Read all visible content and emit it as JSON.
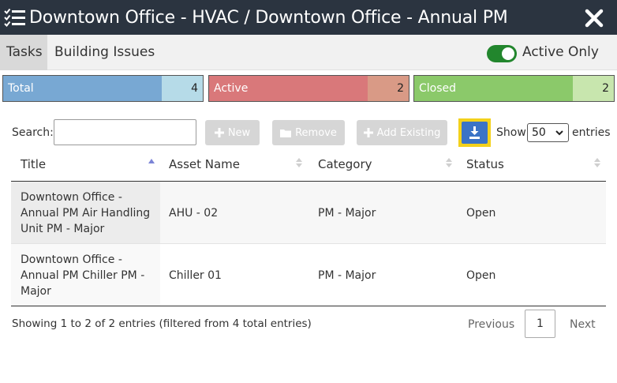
{
  "header": {
    "title": "Downtown Office - HVAC / Downtown Office - Annual PM"
  },
  "tabs": [
    {
      "label": "Tasks",
      "active": true
    },
    {
      "label": "Building Issues",
      "active": false
    }
  ],
  "filter": {
    "active_only_label": "Active Only",
    "active_only_on": true
  },
  "summary": {
    "total": {
      "label": "Total",
      "value": "4"
    },
    "active": {
      "label": "Active",
      "value": "2"
    },
    "closed": {
      "label": "Closed",
      "value": "2"
    }
  },
  "toolbar": {
    "search_label": "Search:",
    "search_value": "",
    "new_label": "New",
    "remove_label": "Remove",
    "add_existing_label": "Add Existing",
    "show_label": "Show",
    "entries_value": "50",
    "entries_label": "entries"
  },
  "table": {
    "columns": [
      "Title",
      "Asset Name",
      "Category",
      "Status"
    ],
    "rows": [
      {
        "title": "Downtown Office - Annual PM Air Handling Unit PM - Major",
        "asset": "AHU - 02",
        "category": "PM - Major",
        "status": "Open"
      },
      {
        "title": "Downtown Office - Annual PM Chiller PM - Major",
        "asset": "Chiller 01",
        "category": "PM - Major",
        "status": "Open"
      }
    ]
  },
  "footer": {
    "info": "Showing 1 to 2 of 2 entries (filtered from 4 total entries)",
    "previous_label": "Previous",
    "current_page": "1",
    "next_label": "Next"
  },
  "colors": {
    "header_bg": "#2b3440",
    "toggle_on": "#22862d",
    "total_label": "#78a8d3",
    "active_label": "#d9787a",
    "closed_label": "#8bc96a",
    "download_button": "#3a73c6",
    "highlight": "#f3d11b"
  },
  "icons": {
    "header": "task-list-icon",
    "close": "close-icon",
    "new": "plus-icon",
    "remove": "folder-icon",
    "add_existing": "plus-icon",
    "download": "download-icon"
  }
}
